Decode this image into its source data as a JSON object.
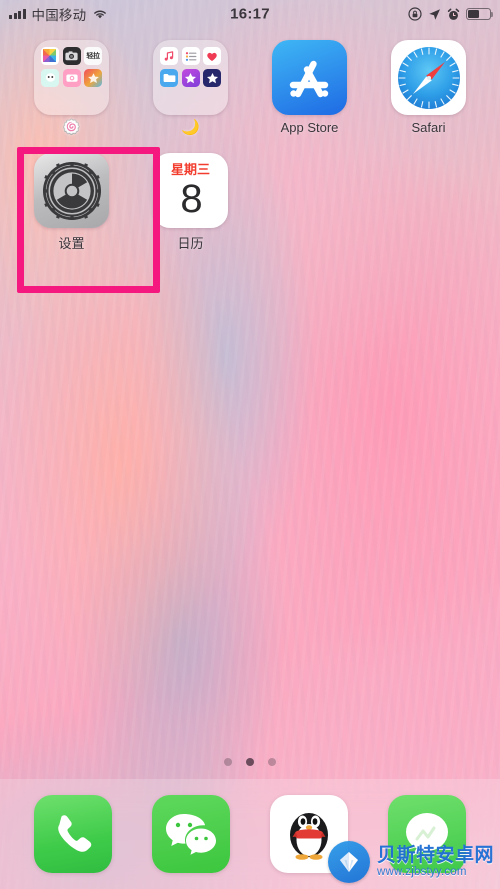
{
  "status_bar": {
    "carrier": "中国移动",
    "signal_icon": "signal-bars-icon",
    "wifi_icon": "wifi-icon",
    "time": "16:17",
    "rotation_lock_icon": "rotation-lock-icon",
    "location_icon": "location-arrow-icon",
    "alarm_icon": "alarm-clock-icon",
    "battery_icon": "battery-icon",
    "battery_level_percent": 52
  },
  "home_screen": {
    "apps": [
      {
        "id": "folder-1",
        "type": "folder",
        "label": "🍥",
        "label_is_emoji": true,
        "mini_icons": [
          {
            "name": "photos-icon",
            "glyph": ""
          },
          {
            "name": "camera-icon",
            "glyph": "📷"
          },
          {
            "name": "text-note-icon",
            "glyph": "轻拉"
          },
          {
            "name": "face-app-icon",
            "glyph": "😶"
          },
          {
            "name": "pink-camera-icon",
            "glyph": "◉"
          },
          {
            "name": "colorful-art-icon",
            "glyph": "🎨"
          }
        ]
      },
      {
        "id": "folder-2",
        "type": "folder",
        "label": "🌙",
        "label_is_emoji": true,
        "mini_icons": [
          {
            "name": "music-icon",
            "glyph": "♫"
          },
          {
            "name": "reminders-icon",
            "glyph": "☰"
          },
          {
            "name": "health-icon",
            "glyph": "♥"
          },
          {
            "name": "files-icon",
            "glyph": "▭"
          },
          {
            "name": "purple-star-icon",
            "glyph": "★"
          },
          {
            "name": "imovie-star-icon",
            "glyph": "☆"
          }
        ]
      },
      {
        "id": "app-store",
        "type": "app",
        "label": "App Store",
        "icon_name": "app-store-icon"
      },
      {
        "id": "safari",
        "type": "app",
        "label": "Safari",
        "icon_name": "safari-compass-icon"
      },
      {
        "id": "settings",
        "type": "app",
        "label": "设置",
        "icon_name": "settings-gear-icon",
        "highlighted": true
      },
      {
        "id": "calendar",
        "type": "app",
        "label": "日历",
        "icon_name": "calendar-icon",
        "weekday": "星期三",
        "day_number": "8"
      }
    ]
  },
  "highlight": {
    "target": "设置",
    "color": "#f5197f",
    "border_width_px": 7
  },
  "page_dots": {
    "count": 3,
    "active_index": 1
  },
  "dock": {
    "items": [
      {
        "id": "phone",
        "icon_name": "phone-handset-icon",
        "label": ""
      },
      {
        "id": "wechat",
        "icon_name": "wechat-bubbles-icon",
        "label": ""
      },
      {
        "id": "qq",
        "icon_name": "qq-penguin-icon",
        "label": ""
      },
      {
        "id": "green-app",
        "icon_name": "green-messaging-icon",
        "label": ""
      }
    ]
  },
  "watermark": {
    "site_name": "贝斯特安卓网",
    "url": "www.zjbstyy.com",
    "badge_icon": "shell-diamond-logo-icon",
    "accent_color": "#1f6fd4"
  }
}
